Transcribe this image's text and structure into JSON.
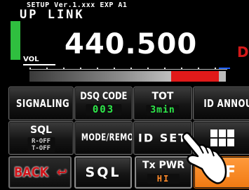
{
  "status": {
    "setup_line": "SETUP   Ver.1.xxx EXP A1",
    "band": "UP LINK",
    "vol_label": "VOL",
    "frequency": "440.500",
    "mode_tag": "DN"
  },
  "meter": {
    "level_fraction": 0.7,
    "colors": {
      "low": "#3a3a3a",
      "high": "#e11a1a"
    }
  },
  "buttons": {
    "signaling": "SIGNALING",
    "dsq_code": {
      "label": "DSQ CODE",
      "value": "003"
    },
    "tot": {
      "label": "TOT",
      "value": "3min"
    },
    "id_announce": "ID ANNOUNC",
    "sql": {
      "label": "SQL",
      "value_line1": "R-OFF",
      "value_line2": "T-OFF"
    },
    "mode_remote": "MODE/REMOTE",
    "id_set": "ID SET",
    "menu_icon": "grid-menu-icon",
    "back": "BACK",
    "sql_key": "SQL",
    "tx_pwr": {
      "label": "Tx PWR",
      "value": "HI"
    },
    "f_key": "F"
  },
  "colors": {
    "accent": "#2ee94a",
    "orange": "#f07a12",
    "back_red": "#d0141a"
  }
}
